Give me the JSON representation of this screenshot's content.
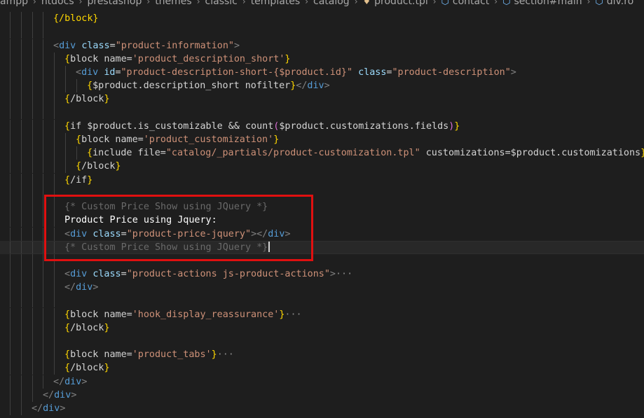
{
  "breadcrumb": {
    "items": [
      {
        "label": "ampp",
        "icon": ""
      },
      {
        "label": "htdocs",
        "icon": ""
      },
      {
        "label": "prestashop",
        "icon": ""
      },
      {
        "label": "themes",
        "icon": ""
      },
      {
        "label": "classic",
        "icon": ""
      },
      {
        "label": "templates",
        "icon": ""
      },
      {
        "label": "catalog",
        "icon": ""
      },
      {
        "label": "product.tpl",
        "icon": "lightbulb-icon"
      },
      {
        "label": "contact",
        "icon": "cube-icon"
      },
      {
        "label": "section#main",
        "icon": "cube-icon"
      },
      {
        "label": "div.ro",
        "icon": "cube-icon"
      }
    ],
    "separator": "›"
  },
  "editor": {
    "lines": [
      {
        "text": "{/block}"
      },
      {
        "text": ""
      },
      {
        "text": "<div class=\"product-information\">"
      },
      {
        "text": "{block name='product_description_short'}"
      },
      {
        "text": "<div id=\"product-description-short-{$product.id}\" class=\"product-description\">"
      },
      {
        "text": "{$product.description_short nofilter}</div>"
      },
      {
        "text": "{/block}"
      },
      {
        "text": ""
      },
      {
        "text": "{if $product.is_customizable && count($product.customizations.fields)}"
      },
      {
        "text": "{block name='product_customization'}"
      },
      {
        "text": "{include file=\"catalog/_partials/product-customization.tpl\" customizations=$product.customizations}"
      },
      {
        "text": "{/block}"
      },
      {
        "text": "{/if}"
      },
      {
        "text": ""
      },
      {
        "text": "{* Custom Price Show using JQuery *}"
      },
      {
        "text": "Product Price using Jquery:"
      },
      {
        "text": "<div class=\"product-price-jquery\"></div>"
      },
      {
        "text": "{* Custom Price Show using JQuery *}"
      },
      {
        "text": ""
      },
      {
        "text": "<div class=\"product-actions js-product-actions\">",
        "folded": true
      },
      {
        "text": "</div>"
      },
      {
        "text": ""
      },
      {
        "text": "{block name='hook_display_reassurance'}",
        "folded": true
      },
      {
        "text": "{/block}"
      },
      {
        "text": ""
      },
      {
        "text": "{block name='product_tabs'}",
        "folded": true
      },
      {
        "text": "{/block}"
      },
      {
        "text": "</div>"
      },
      {
        "text": "</div>"
      },
      {
        "text": "</div>"
      }
    ],
    "fold_ellipsis": "···",
    "fold_chevron": "›"
  },
  "colors": {
    "background": "#1e1e1e",
    "tag": "#569cd6",
    "attribute": "#9cdcfe",
    "string": "#ce9178",
    "brace": "#ffd700",
    "comment": "#6a6a6a",
    "highlight_box": "#e01010"
  }
}
